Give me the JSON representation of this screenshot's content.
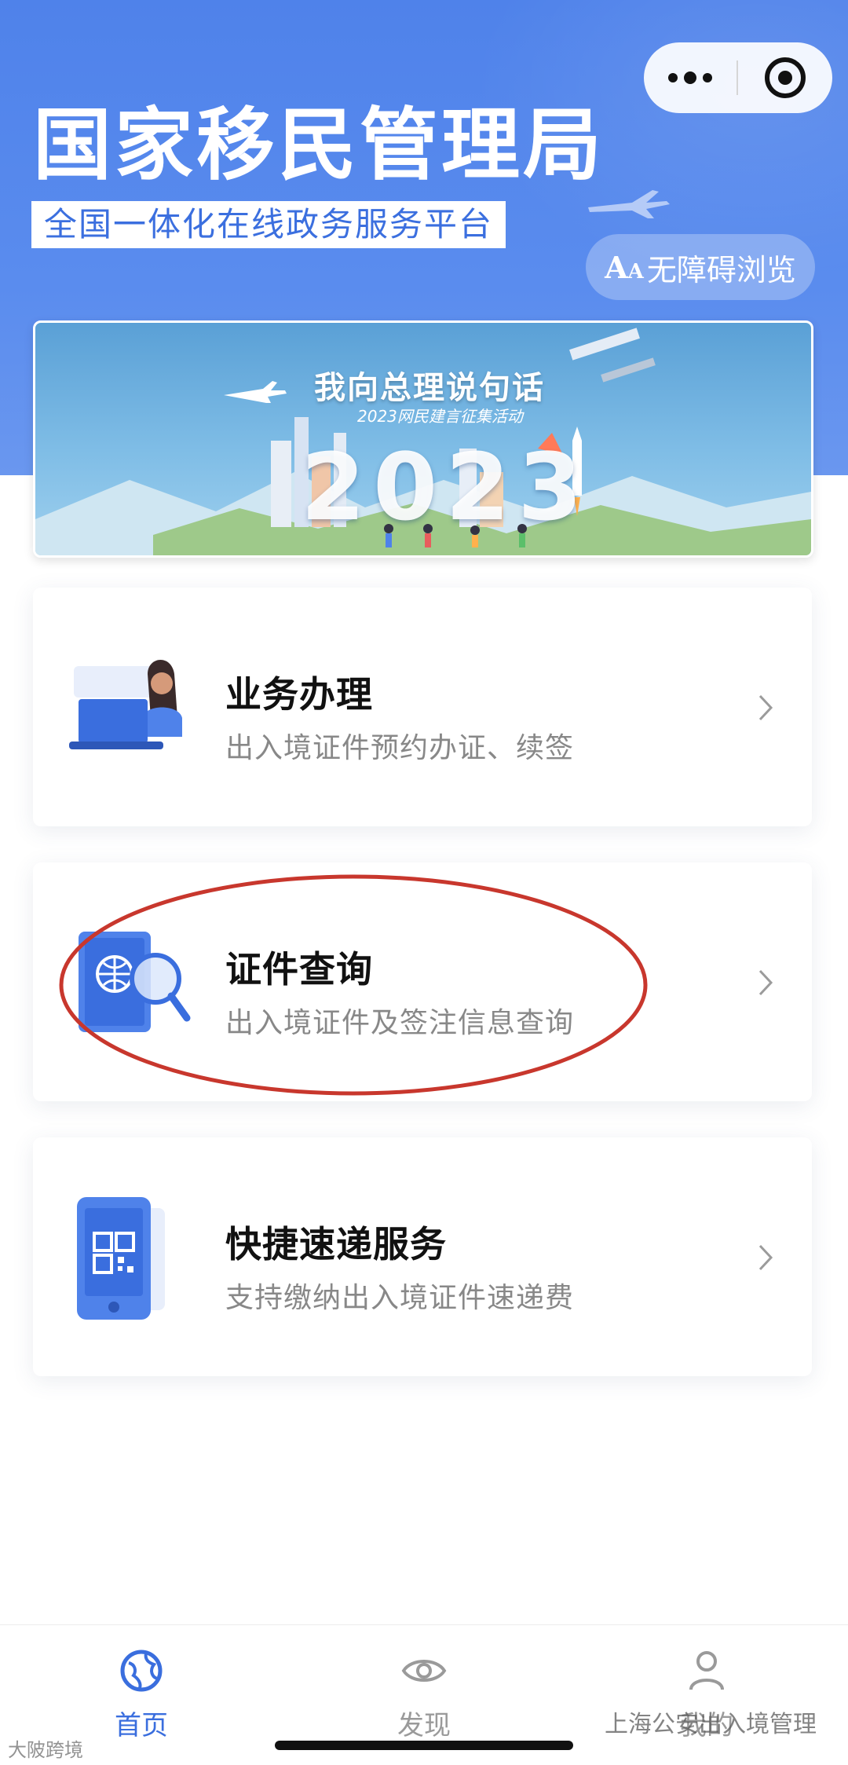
{
  "header": {
    "title": "国家移民管理局",
    "subtitle": "全国一体化在线政务服务平台",
    "accessibility_button": "无障碍浏览",
    "accessibility_icon": "AA-icon"
  },
  "capsule": {
    "more_icon": "more-dots-icon",
    "close_icon": "target-close-icon"
  },
  "banner": {
    "headline": "我向总理说句话",
    "subline": "2023网民建言征集活动",
    "year": "2023"
  },
  "services": [
    {
      "title": "业务办理",
      "description": "出入境证件预约办证、续签",
      "icon": "laptop-person-icon"
    },
    {
      "title": "证件查询",
      "description": "出入境证件及签注信息查询",
      "icon": "passport-search-icon"
    },
    {
      "title": "快捷速递服务",
      "description": "支持缴纳出入境证件速递费",
      "icon": "phone-qrcode-icon"
    }
  ],
  "tabbar": {
    "tabs": [
      {
        "label": "首页",
        "icon": "globe-icon",
        "active": true
      },
      {
        "label": "发现",
        "icon": "eye-icon",
        "active": false
      },
      {
        "label": "我的",
        "icon": "user-icon",
        "active": false
      }
    ]
  },
  "watermarks": {
    "left": "大陂跨境",
    "right": "上海公安出入境管理"
  },
  "colors": {
    "header_blue": "#4f82ea",
    "accent_blue": "#3a6ede",
    "annotation_red": "#c8372d"
  }
}
